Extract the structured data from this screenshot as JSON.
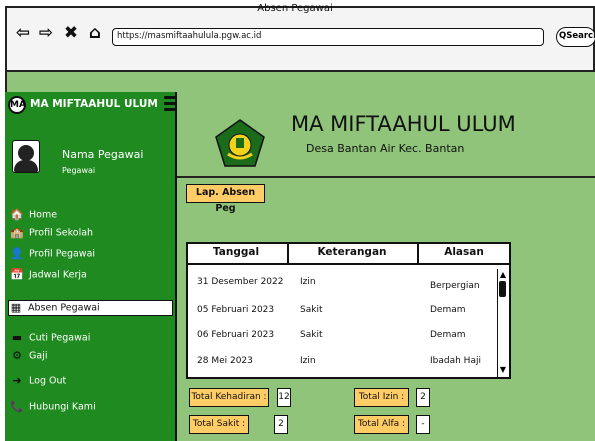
{
  "browser": {
    "title": "Absen Pegawai",
    "url": "https://masmiftaahulula.pgw.ac.id",
    "search_label": "Search"
  },
  "sidebar": {
    "brand": "MA MIFTAAHUL ULUM",
    "user_name": "Nama Pegawai",
    "user_role": "Pegawai",
    "items": [
      {
        "label": "Home",
        "icon": "home-icon"
      },
      {
        "label": "Profil Sekolah",
        "icon": "school-icon"
      },
      {
        "label": "Profil Pegawai",
        "icon": "user-profile-icon"
      },
      {
        "label": "Jadwal Kerja",
        "icon": "calendar-icon"
      },
      {
        "label": "Absen Pegawai",
        "icon": "attendance-icon",
        "active": true
      },
      {
        "label": "Cuti Pegawai",
        "icon": "leave-icon"
      },
      {
        "label": "Gaji",
        "icon": "salary-icon"
      },
      {
        "label": "Log Out",
        "icon": "logout-icon"
      },
      {
        "label": "Hubungi Kami",
        "icon": "phone-icon"
      }
    ]
  },
  "header": {
    "school_name": "MA MIFTAAHUL ULUM",
    "address": "Desa Bantan Air Kec. Bantan"
  },
  "report_button": "Lap. Absen Peg",
  "table": {
    "columns": [
      "Tanggal",
      "Keterangan",
      "Alasan"
    ],
    "rows": [
      [
        "31 Desember 2022",
        "Izin",
        "Berpergian"
      ],
      [
        "05 Februari 2023",
        "Sakit",
        "Demam"
      ],
      [
        "06 Februari 2023",
        "Sakit",
        "Demam"
      ],
      [
        "28 Mei 2023",
        "Izin",
        "Ibadah Haji"
      ]
    ]
  },
  "summary": {
    "kehadiran_label": "Total Kehadiran :",
    "kehadiran_value": "12",
    "izin_label": "Total Izin :",
    "izin_value": "2",
    "sakit_label": "Total Sakit :",
    "sakit_value": "2",
    "alfa_label": "Total Alfa :",
    "alfa_value": "-"
  },
  "colors": {
    "sidebar": "#1f8a1f",
    "content": "#8fc47a",
    "accent_button": "#ffcc66"
  }
}
